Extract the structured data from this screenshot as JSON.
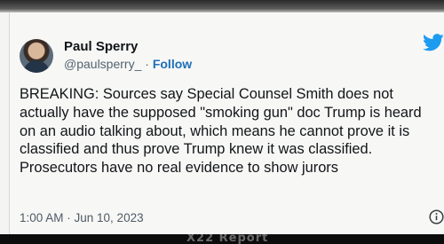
{
  "tweet": {
    "author": {
      "display_name": "Paul Sperry",
      "handle": "@paulsperry_",
      "separator": " · ",
      "follow_label": "Follow",
      "avatar_icon": "profile-photo"
    },
    "brand_icon": "twitter-bird-icon",
    "brand_color": "#1d9bf0",
    "text": "BREAKING: Sources say Special Counsel Smith does not actually have the supposed \"smoking gun\" doc Trump is heard on an audio talking about, which means he cannot prove it is classified and thus prove Trump knew it was classified. Prosecutors have no real evidence to show jurors",
    "timestamp": "1:00 AM · Jun 10, 2023",
    "info_icon": "info-circle-icon"
  },
  "broadcast": {
    "ticker_text": "X22 Report"
  }
}
